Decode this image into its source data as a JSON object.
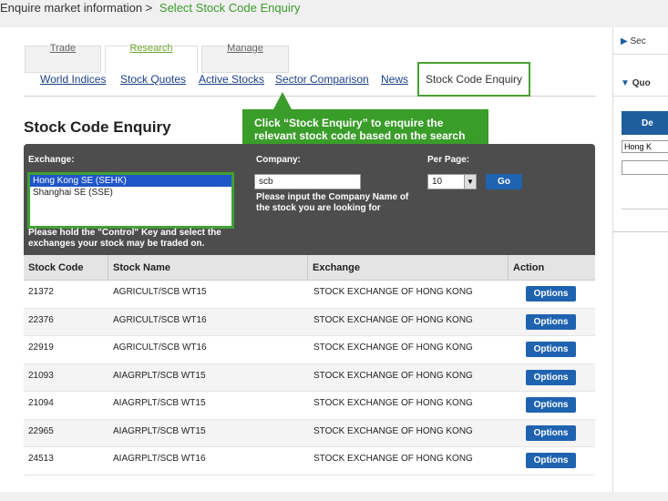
{
  "breadcrumb": {
    "parent": "Enquire market information >",
    "current": "Select Stock Code Enquiry"
  },
  "main_tabs": [
    "Trade",
    "Research",
    "Manage"
  ],
  "sub_tabs": [
    "World Indices",
    "Stock Quotes",
    "Active Stocks",
    "Sector Comparison",
    "News",
    "Stock Code Enquiry"
  ],
  "page_title": "Stock Code Enquiry",
  "callout": "Click “Stock Enquiry” to enquire the relevant stock code based on the search",
  "filters": {
    "exchange_label": "Exchange:",
    "exchange_options": [
      "Hong Kong SE (SEHK)",
      "Shanghai SE (SSE)"
    ],
    "exchange_note": "Please hold the \"Control\" Key and select the exchanges your stock may be traded on.",
    "company_label": "Company:",
    "company_value": "scb",
    "company_note": "Please input the Company Name of the stock you are looking for",
    "perpage_label": "Per Page:",
    "perpage_value": "10",
    "go_label": "Go"
  },
  "table": {
    "headers": [
      "Stock Code",
      "Stock Name",
      "Exchange",
      "Action"
    ],
    "rows": [
      {
        "code": "21372",
        "name": "AGRICULT/SCB WT15",
        "exchange": "STOCK EXCHANGE OF HONG KONG",
        "action": "Options"
      },
      {
        "code": "22376",
        "name": "AGRICULT/SCB WT16",
        "exchange": "STOCK EXCHANGE OF HONG KONG",
        "action": "Options"
      },
      {
        "code": "22919",
        "name": "AGRICULT/SCB WT16",
        "exchange": "STOCK EXCHANGE OF HONG KONG",
        "action": "Options"
      },
      {
        "code": "21093",
        "name": "AIAGRPLT/SCB WT15",
        "exchange": "STOCK EXCHANGE OF HONG KONG",
        "action": "Options"
      },
      {
        "code": "21094",
        "name": "AIAGRPLT/SCB WT15",
        "exchange": "STOCK EXCHANGE OF HONG KONG",
        "action": "Options"
      },
      {
        "code": "22965",
        "name": "AIAGRPLT/SCB WT15",
        "exchange": "STOCK EXCHANGE OF HONG KONG",
        "action": "Options"
      },
      {
        "code": "24513",
        "name": "AIAGRPLT/SCB WT16",
        "exchange": "STOCK EXCHANGE OF HONG KONG",
        "action": "Options"
      }
    ]
  },
  "sidebar": {
    "section1": "Sec",
    "section2": "Quo",
    "button": "De",
    "input_value": "Hong K"
  }
}
